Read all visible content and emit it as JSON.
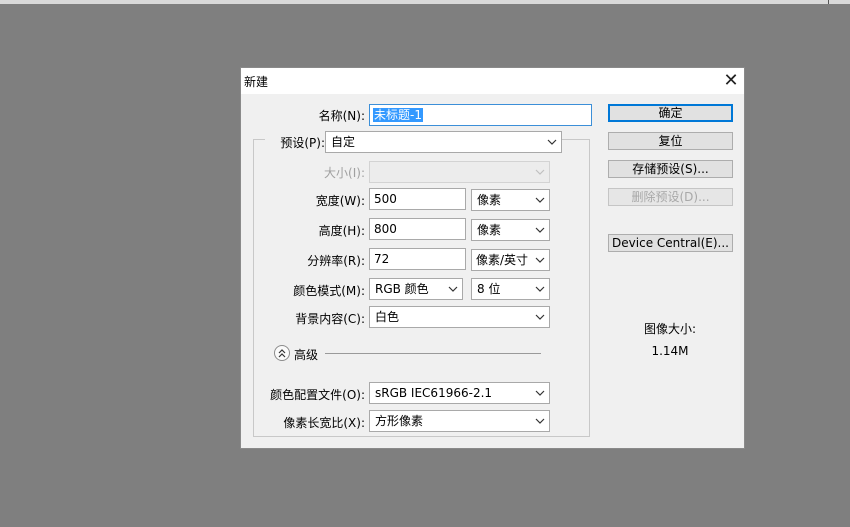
{
  "dialog": {
    "title": "新建",
    "close_glyph": "✕"
  },
  "form": {
    "name": {
      "label": "名称(N):",
      "value": "未标题-1"
    },
    "preset": {
      "label": "预设(P):",
      "value": "自定"
    },
    "size": {
      "label": "大小(I):",
      "value": ""
    },
    "width": {
      "label": "宽度(W):",
      "value": "500",
      "unit": "像素"
    },
    "height": {
      "label": "高度(H):",
      "value": "800",
      "unit": "像素"
    },
    "resolution": {
      "label": "分辨率(R):",
      "value": "72",
      "unit": "像素/英寸"
    },
    "color_mode": {
      "label": "颜色模式(M):",
      "value": "RGB 颜色",
      "bits": "8 位"
    },
    "background": {
      "label": "背景内容(C):",
      "value": "白色"
    },
    "advanced": {
      "label": "高级",
      "icon": "double-chevron-up-icon"
    },
    "color_profile": {
      "label": "颜色配置文件(O):",
      "value": "sRGB IEC61966-2.1"
    },
    "pixel_aspect": {
      "label": "像素长宽比(X):",
      "value": "方形像素"
    }
  },
  "buttons": {
    "ok": "确定",
    "reset": "复位",
    "save_preset": "存储预设(S)...",
    "delete_preset": "删除预设(D)...",
    "device_central": "Device Central(E)..."
  },
  "image_size": {
    "label": "图像大小:",
    "value": "1.14M"
  },
  "colors": {
    "accent": "#0078d7",
    "selection": "#3399ff",
    "workspace": "#7f7f7f"
  }
}
